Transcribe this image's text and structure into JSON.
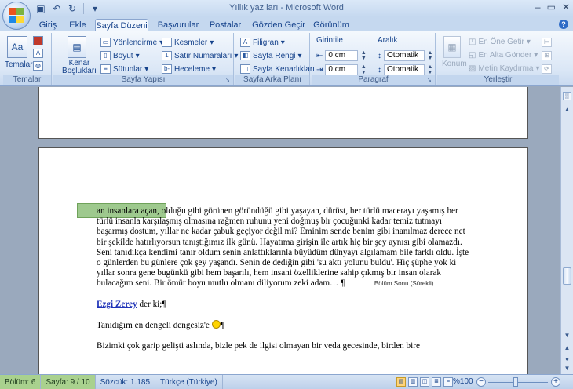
{
  "window": {
    "title": "Yıllık yazıları - Microsoft Word"
  },
  "tabs": [
    "Giriş",
    "Ekle",
    "Sayfa Düzeni",
    "Başvurular",
    "Postalar",
    "Gözden Geçir",
    "Görünüm"
  ],
  "active_tab": "Sayfa Düzeni",
  "ribbon": {
    "temalar": {
      "button": "Temalar",
      "group": "Temalar"
    },
    "sayfa_yapisi": {
      "kenar": "Kenar Boşlukları",
      "yonlendirme": "Yönlendirme",
      "boyut": "Boyut",
      "sutunlar": "Sütunlar",
      "kesmeler": "Kesmeler",
      "satir_numaralari": "Satır Numaraları",
      "heceleme": "Heceleme",
      "group": "Sayfa Yapısı"
    },
    "sayfa_arka_plani": {
      "filigran": "Filigran",
      "sayfa_rengi": "Sayfa Rengi",
      "sayfa_kenarliklari": "Sayfa Kenarlıkları",
      "group": "Sayfa Arka Planı"
    },
    "paragraf": {
      "girintile": "Girintile",
      "aralik": "Aralık",
      "left_indent": "0 cm",
      "right_indent": "0 cm",
      "before": "Otomatik",
      "after": "Otomatik",
      "group": "Paragraf"
    },
    "yerlestir": {
      "konum": "Konum",
      "en_one_getir": "En Öne Getir",
      "en_alta_gonder": "En Alta Gönder",
      "metin_kaydirma": "Metin Kaydırma",
      "group": "Yerleştir"
    }
  },
  "document": {
    "highlight_text": "an insanlara  açan,",
    "paragraph1_rest": "olduğu gibi görünen göründüğü gibi yaşayan, dürüst, her türlü macerayı yaşamış her türlü insanla karşılaşmış olmasına rağmen ruhunu yeni doğmuş bir çocuğunki kadar temiz tutmayı başarmış dostum, yıllar ne kadar çabuk geçiyor değil mi? Eminim sende benim gibi inanılmaz derece net bir şekilde hatırlıyorsun tanıştığımız ilk günü. Hayatıma girişin ile artık hiç bir şey aynısı gibi olamazdı. Seni tanıdıkça kendimi tanır oldum senin anlattıklarınla büyüdüm dünyayı algılamam bile farklı oldu. İşte o günlerden bu günlere çok şey yaşandı. Senin de dediğin gibi 'su aktı yolunu buldu'. Hiç şüphe yok ki yıllar sonra gene bugünkü gibi hem başarılı, hem insani özelliklerine sahip çıkmış bir insan olarak bulacağım seni. Bir ömür boyu mutlu olmanı diliyorum zeki adam…",
    "section_break": "Bölüm Sonu (Sürekli)",
    "name_link": "Ezgi Zerey",
    "name_suffix": " der ki;",
    "line3": "Tanıdığım en dengeli dengesiz'e",
    "line4": "Bizimki çok garip gelişti aslında, bizle pek de ilgisi olmayan bir veda gecesinde, birden bire"
  },
  "status": {
    "bolum": "Bölüm: 6",
    "sayfa": "Sayfa: 9 / 10",
    "sozcuk": "Sözcük: 1.185",
    "dil": "Türkçe (Türkiye)",
    "zoom": "%100"
  },
  "colors": {
    "ribbon_bg": "#dbe7f6",
    "status_green": "#a9d18e",
    "highlight": "#9ec98e",
    "link": "#1f33b8"
  }
}
